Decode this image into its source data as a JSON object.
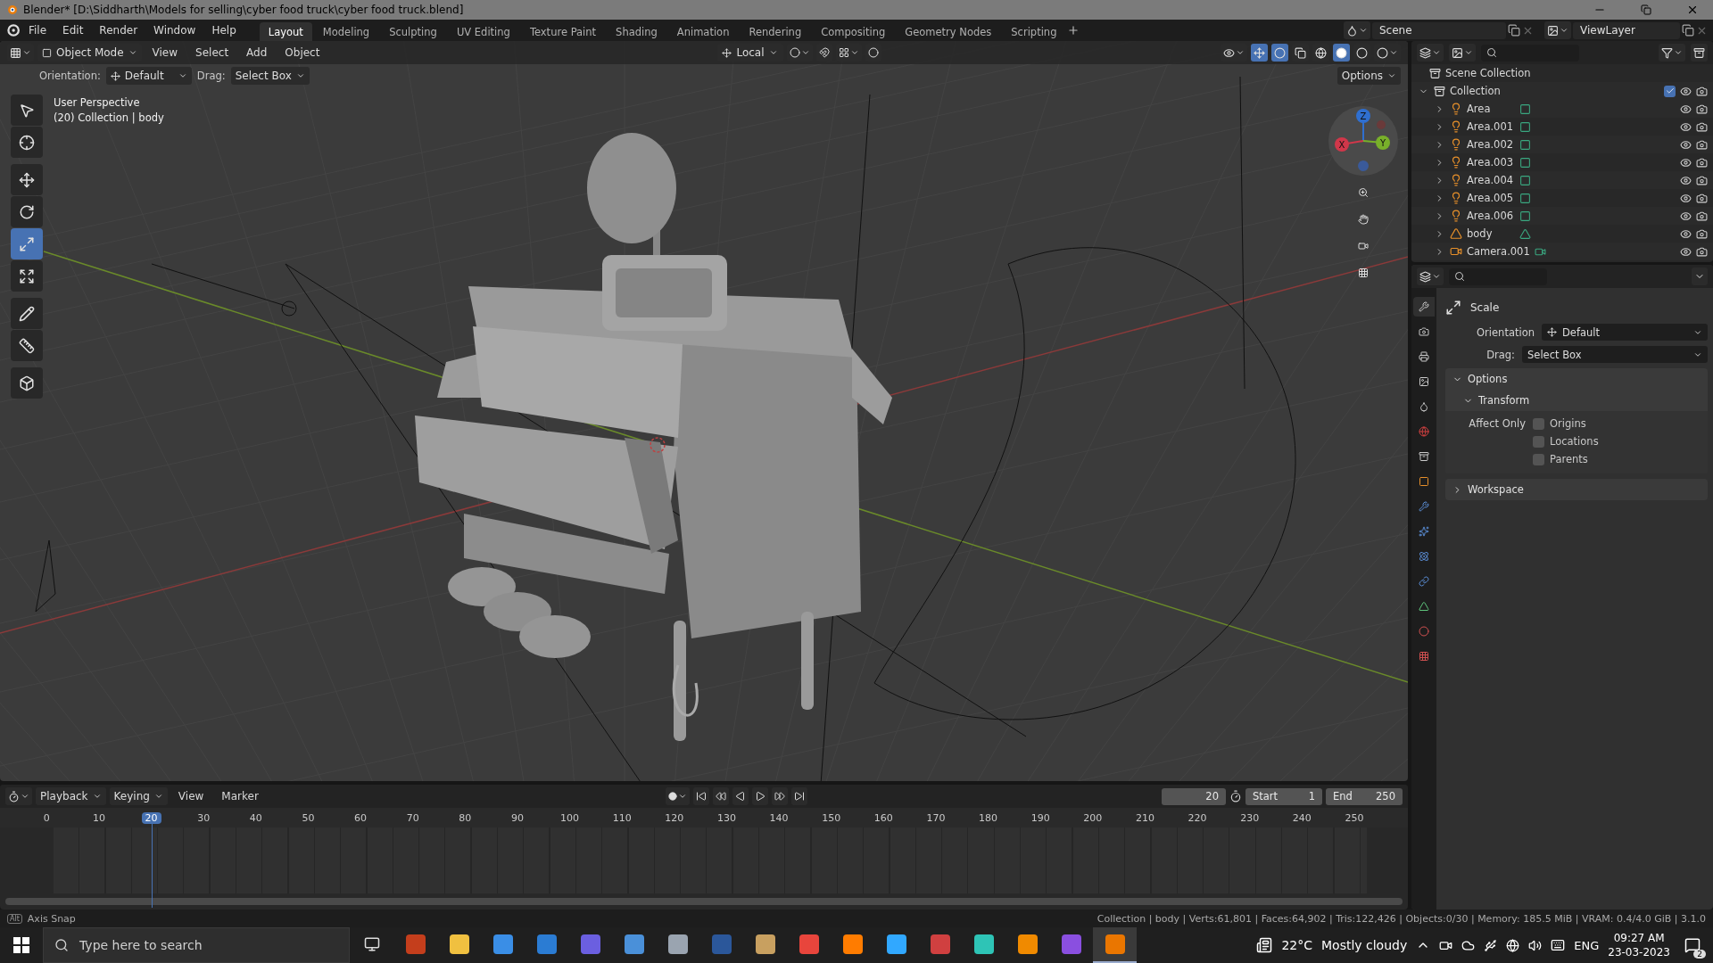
{
  "window": {
    "title": "Blender* [D:\\Siddharth\\Models for selling\\cyber food truck\\cyber food truck.blend]"
  },
  "menu": [
    "File",
    "Edit",
    "Render",
    "Window",
    "Help"
  ],
  "workspaces": [
    {
      "label": "Layout",
      "selected": true
    },
    {
      "label": "Modeling",
      "selected": false
    },
    {
      "label": "Sculpting",
      "selected": false
    },
    {
      "label": "UV Editing",
      "selected": false
    },
    {
      "label": "Texture Paint",
      "selected": false
    },
    {
      "label": "Shading",
      "selected": false
    },
    {
      "label": "Animation",
      "selected": false
    },
    {
      "label": "Rendering",
      "selected": false
    },
    {
      "label": "Compositing",
      "selected": false
    },
    {
      "label": "Geometry Nodes",
      "selected": false
    },
    {
      "label": "Scripting",
      "selected": false
    }
  ],
  "scene": {
    "name": "Scene"
  },
  "view_layer": {
    "name": "ViewLayer"
  },
  "viewport": {
    "mode": "Object Mode",
    "menus": [
      "View",
      "Select",
      "Add",
      "Object"
    ],
    "pivot": "Local",
    "orientation_label": "Orientation:",
    "orientation": "Default",
    "drag_label": "Drag:",
    "drag": "Select Box",
    "options": "Options",
    "info": [
      "User Perspective",
      "(20) Collection | body"
    ],
    "tools": [
      {
        "kind": "select",
        "selected": false
      },
      {
        "kind": "cursor",
        "selected": false
      },
      {
        "kind": "move",
        "selected": false
      },
      {
        "kind": "rotate",
        "selected": false
      },
      {
        "kind": "scale",
        "selected": true
      },
      {
        "kind": "transform",
        "selected": false
      },
      {
        "kind": "annotate",
        "selected": false
      },
      {
        "kind": "measure",
        "selected": false
      },
      {
        "kind": "add-cube",
        "selected": false
      }
    ],
    "gizmo_axes": [
      {
        "label": "Z",
        "color": "#2f6fd0"
      },
      {
        "label": "X",
        "color": "#d0374a"
      },
      {
        "label": "Y",
        "color": "#78b02a"
      }
    ]
  },
  "outliner": {
    "root": "Scene Collection",
    "collection": {
      "name": "Collection",
      "expanded": true,
      "checked": true,
      "children": [
        {
          "name": "Area",
          "kind": "light",
          "expanded": false
        },
        {
          "name": "Area.001",
          "kind": "light",
          "expanded": false
        },
        {
          "name": "Area.002",
          "kind": "light",
          "expanded": false
        },
        {
          "name": "Area.003",
          "kind": "light",
          "expanded": false
        },
        {
          "name": "Area.004",
          "kind": "light",
          "expanded": false
        },
        {
          "name": "Area.005",
          "kind": "light",
          "expanded": false
        },
        {
          "name": "Area.006",
          "kind": "light",
          "expanded": false
        },
        {
          "name": "body",
          "kind": "mesh",
          "expanded": false
        },
        {
          "name": "Camera.001",
          "kind": "camera",
          "expanded": false
        }
      ]
    }
  },
  "properties": {
    "tabs": [
      {
        "kind": "tool",
        "selected": true
      },
      {
        "kind": "render",
        "selected": false
      },
      {
        "kind": "output",
        "selected": false
      },
      {
        "kind": "view-layer",
        "selected": false
      },
      {
        "kind": "scene",
        "selected": false
      },
      {
        "kind": "world",
        "selected": false
      },
      {
        "kind": "collection",
        "selected": false
      },
      {
        "kind": "object",
        "selected": false
      },
      {
        "kind": "modifiers",
        "selected": false
      },
      {
        "kind": "particles",
        "selected": false
      },
      {
        "kind": "physics",
        "selected": false
      },
      {
        "kind": "constraints",
        "selected": false
      },
      {
        "kind": "data",
        "selected": false
      },
      {
        "kind": "material",
        "selected": false
      },
      {
        "kind": "texture",
        "selected": false
      }
    ],
    "tool": "Scale",
    "orientation_label": "Orientation",
    "orientation": "Default",
    "drag_label": "Drag:",
    "drag": "Select Box",
    "panels": [
      {
        "title": "Options",
        "expanded": true,
        "subpanels": [
          {
            "title": "Transform",
            "expanded": true,
            "label": "Affect Only",
            "options": [
              {
                "label": "Origins",
                "checked": false
              },
              {
                "label": "Locations",
                "checked": false
              },
              {
                "label": "Parents",
                "checked": false
              }
            ]
          }
        ]
      },
      {
        "title": "Workspace",
        "expanded": false
      }
    ]
  },
  "timeline": {
    "menus": [
      "Playback",
      "Keying",
      "View",
      "Marker"
    ],
    "current_frame": "20",
    "start_label": "Start",
    "start": "1",
    "end_label": "End",
    "end": "250",
    "ticks": [
      {
        "label": "0",
        "selected": false
      },
      {
        "label": "10",
        "selected": false
      },
      {
        "label": "20",
        "selected": true
      },
      {
        "label": "30",
        "selected": false
      },
      {
        "label": "40",
        "selected": false
      },
      {
        "label": "50",
        "selected": false
      },
      {
        "label": "60",
        "selected": false
      },
      {
        "label": "70",
        "selected": false
      },
      {
        "label": "80",
        "selected": false
      },
      {
        "label": "90",
        "selected": false
      },
      {
        "label": "100",
        "selected": false
      },
      {
        "label": "110",
        "selected": false
      },
      {
        "label": "120",
        "selected": false
      },
      {
        "label": "130",
        "selected": false
      },
      {
        "label": "140",
        "selected": false
      },
      {
        "label": "150",
        "selected": false
      },
      {
        "label": "160",
        "selected": false
      },
      {
        "label": "170",
        "selected": false
      },
      {
        "label": "180",
        "selected": false
      },
      {
        "label": "190",
        "selected": false
      },
      {
        "label": "200",
        "selected": false
      },
      {
        "label": "210",
        "selected": false
      },
      {
        "label": "220",
        "selected": false
      },
      {
        "label": "230",
        "selected": false
      },
      {
        "label": "240",
        "selected": false
      },
      {
        "label": "250",
        "selected": false
      }
    ]
  },
  "status_bar": {
    "key": "Alt",
    "hint": "Axis Snap",
    "stats": "Collection | body | Verts:61,801 | Faces:64,902 | Tris:122,426 | Objects:0/30 | Memory: 185.5 MiB | VRAM: 0.4/4.0 GiB | 3.1.0"
  },
  "taskbar": {
    "search_placeholder": "Type here to search",
    "apps": [
      {
        "color": "#c43e1c",
        "selected": false
      },
      {
        "color": "#f0c040",
        "selected": false
      },
      {
        "color": "#3a8ee6",
        "selected": false
      },
      {
        "color": "#2b7cd3",
        "selected": false
      },
      {
        "color": "#6b5fe0",
        "selected": false
      },
      {
        "color": "#4a90d9",
        "selected": false
      },
      {
        "color": "#9aa4b0",
        "selected": false
      },
      {
        "color": "#2b579a",
        "selected": false
      },
      {
        "color": "#c8a060",
        "selected": false
      },
      {
        "color": "#e8453c",
        "selected": false
      },
      {
        "color": "#ff7c00",
        "selected": false
      },
      {
        "color": "#31a8ff",
        "selected": false
      },
      {
        "color": "#d04040",
        "selected": false
      },
      {
        "color": "#2ec4b6",
        "selected": false
      },
      {
        "color": "#f08a00",
        "selected": false
      },
      {
        "color": "#8a4fe0",
        "selected": false
      },
      {
        "color": "#ea7600",
        "selected": true
      }
    ],
    "temperature": "22°C",
    "weather": "Mostly cloudy",
    "language": "ENG",
    "time": "09:27 AM",
    "date": "23-03-2023",
    "notifications": "2"
  }
}
